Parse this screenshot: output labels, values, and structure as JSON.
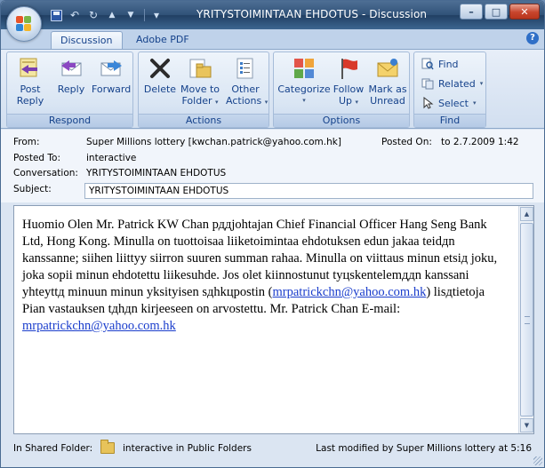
{
  "window": {
    "title": "YRITYSTOIMINTAAN EHDOTUS - Discussion",
    "min_glyph": "–",
    "max_glyph": "□",
    "close_glyph": "✕"
  },
  "qat": {
    "undo_glyph": "↶",
    "redo_glyph": "↻",
    "up_glyph": "▲",
    "down_glyph": "▼",
    "more_glyph": "▾"
  },
  "tabs": {
    "discussion": "Discussion",
    "adobe": "Adobe PDF",
    "help": "?"
  },
  "ribbon": {
    "respond": {
      "label": "Respond",
      "post_reply_1": "Post",
      "post_reply_2": "Reply",
      "reply": "Reply",
      "forward": "Forward"
    },
    "actions": {
      "label": "Actions",
      "delete": "Delete",
      "move_1": "Move to",
      "move_2": "Folder",
      "other_1": "Other",
      "other_2": "Actions"
    },
    "options": {
      "label": "Options",
      "categorize": "Categorize",
      "follow_1": "Follow",
      "follow_2": "Up",
      "mark_1": "Mark as",
      "mark_2": "Unread"
    },
    "find": {
      "label": "Find",
      "find": "Find",
      "related": "Related",
      "select": "Select"
    },
    "dropdown_glyph": "▾"
  },
  "header": {
    "from_label": "From:",
    "from_value": "Super Millions lottery [kwchan.patrick@yahoo.com.hk]",
    "posted_on_label": "Posted On:",
    "posted_on_value": "to 2.7.2009 1:42",
    "posted_to_label": "Posted To:",
    "posted_to_value": "interactive",
    "conversation_label": "Conversation:",
    "conversation_value": "YRITYSTOIMINTAAN EHDOTUS",
    "subject_label": "Subject:",
    "subject_value": "YRITYSTOIMINTAAN EHDOTUS"
  },
  "body": {
    "text_1": "Huomio Olen Mr. Patrick KW Chan рддjohtajan Chief Financial Officer Hang Seng Bank Ltd, Hong Kong. Minulla on tuottoisaa liiketoimintaa ehdotuksen edun jakaa teidдn kanssanne; siihen liittyy siirron suuren summan rahaa. Minulla on viittaus minun etsiд joku, joka sopii minun ehdotettu liikesuhde. Jos olet kiinnostunut tyцskentelemддn kanssani yhteyttд minuun minun yksityisen sдhkцpostin (",
    "link_1": "mrpatrickchn@yahoo.com.hk",
    "text_2": ") lisдtietoja Pian vastauksen tдhдn kirjeeseen on arvostettu. Mr. Patrick Chan E-mail: ",
    "link_2": "mrpatrickchn@yahoo.com.hk"
  },
  "scrollbar": {
    "up_glyph": "▲",
    "down_glyph": "▼"
  },
  "status": {
    "in_shared_folder": "In Shared Folder:",
    "folder": "interactive in Public Folders",
    "last_modified": "Last modified by Super Millions lottery at 5:16"
  }
}
